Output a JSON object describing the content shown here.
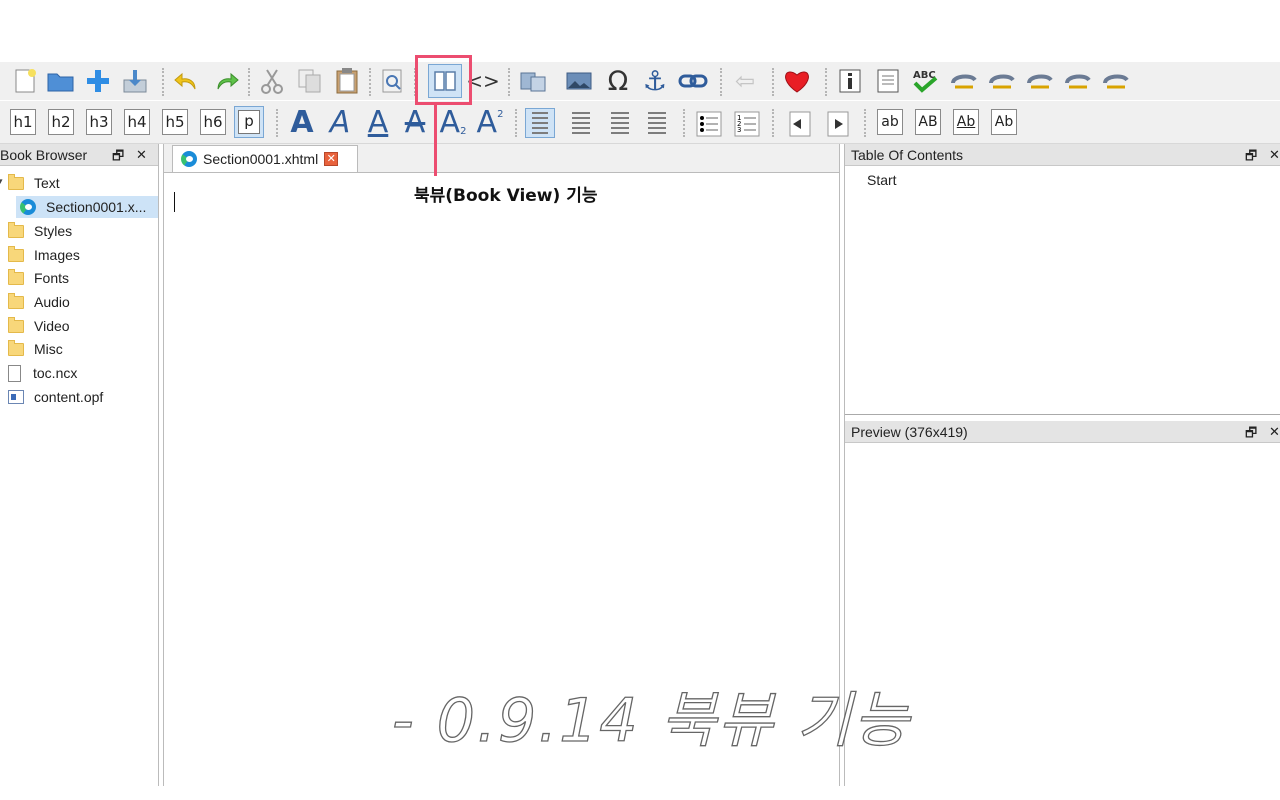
{
  "toolbar_formatting": {
    "heading_buttons": [
      "h1",
      "h2",
      "h3",
      "h4",
      "h5",
      "h6",
      "p"
    ],
    "case_buttons": [
      "ab",
      "AB",
      "Ab",
      "Ab"
    ]
  },
  "book_browser": {
    "title": "Book Browser",
    "items": [
      {
        "label": "Text",
        "icon": "folder-icon"
      },
      {
        "label": "Section0001.x...",
        "icon": "xhtml-file-icon"
      },
      {
        "label": "Styles",
        "icon": "folder-icon"
      },
      {
        "label": "Images",
        "icon": "folder-icon"
      },
      {
        "label": "Fonts",
        "icon": "folder-icon"
      },
      {
        "label": "Audio",
        "icon": "folder-icon"
      },
      {
        "label": "Video",
        "icon": "folder-icon"
      },
      {
        "label": "Misc",
        "icon": "folder-icon"
      },
      {
        "label": "toc.ncx",
        "icon": "file-icon"
      },
      {
        "label": "content.opf",
        "icon": "opf-file-icon"
      }
    ],
    "float_glyph": "🗗",
    "close_glyph": "✕"
  },
  "editor": {
    "tab_label": "Section0001.xhtml",
    "tab_close_glyph": "✕"
  },
  "toc": {
    "title": "Table Of Contents",
    "entries": [
      "Start"
    ]
  },
  "preview": {
    "title": "Preview (376x419)"
  },
  "annotation": {
    "callout": "북뷰(Book View) 기능",
    "caption": "- 0.9.14 북뷰 기능",
    "highlight_color": "#ec4d70"
  }
}
